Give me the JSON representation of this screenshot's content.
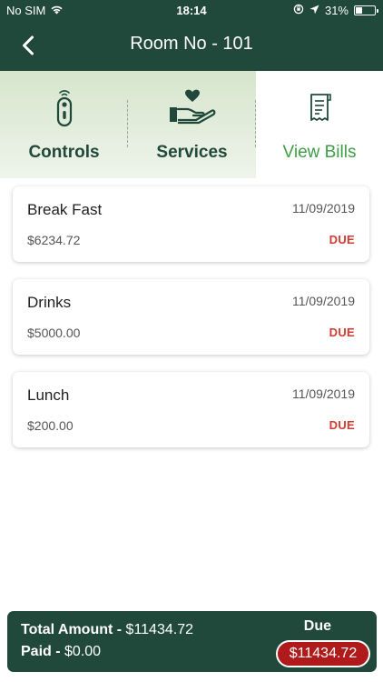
{
  "status_bar": {
    "carrier": "No SIM",
    "time": "18:14",
    "battery": "31%",
    "battery_level": 0.31
  },
  "nav": {
    "title": "Room No - 101",
    "back_icon": "chevron-left-icon"
  },
  "tabs": [
    {
      "label": "Controls",
      "icon": "remote-control-icon"
    },
    {
      "label": "Services",
      "icon": "hand-heart-icon"
    },
    {
      "label": "View Bills",
      "icon": "receipt-icon"
    }
  ],
  "bills": [
    {
      "name": "Break Fast",
      "date": "11/09/2019",
      "amount": "$6234.72",
      "status": "DUE"
    },
    {
      "name": "Drinks",
      "date": "11/09/2019",
      "amount": "$5000.00",
      "status": "DUE"
    },
    {
      "name": "Lunch",
      "date": "11/09/2019",
      "amount": "$200.00",
      "status": "DUE"
    }
  ],
  "footer": {
    "total_label": "Total Amount -",
    "total_value": "$11434.72",
    "paid_label": "Paid -",
    "paid_value": "$0.00",
    "due_label": "Due",
    "due_value": "$11434.72"
  },
  "colors": {
    "primary": "#21493b",
    "accent_green": "#3d9e46",
    "due_red": "#d23b31",
    "due_pill": "#b01a1a"
  }
}
